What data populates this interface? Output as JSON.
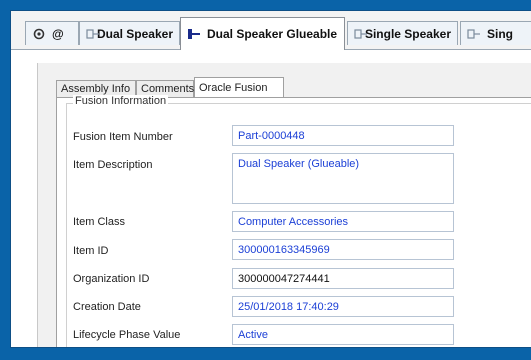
{
  "top_tabs": [
    {
      "label": "@",
      "icon": "settings-icon"
    },
    {
      "label": "Dual Speaker",
      "icon": "component-icon"
    },
    {
      "label": "Dual Speaker Glueable",
      "icon": "connector-icon",
      "active": true
    },
    {
      "label": "Single Speaker",
      "icon": "component-icon"
    },
    {
      "label": "Sing",
      "icon": "component-icon"
    }
  ],
  "sub_tabs": [
    {
      "label": "Assembly Info"
    },
    {
      "label": "Comments"
    },
    {
      "label": "Oracle Fusion",
      "active": true
    }
  ],
  "group": {
    "label": "Fusion Information"
  },
  "fields": [
    {
      "label": "Fusion Item Number",
      "value": "Part-0000448"
    },
    {
      "label": "Item Description",
      "value": "Dual Speaker (Glueable)"
    },
    {
      "label": "Item Class",
      "value": "Computer Accessories"
    },
    {
      "label": "Item ID",
      "value": "300000163345969"
    },
    {
      "label": "Organization ID",
      "value": "300000047274441"
    },
    {
      "label": "Creation Date",
      "value": "25/01/2018 17:40:29"
    },
    {
      "label": "Lifecycle Phase Value",
      "value": "Active"
    }
  ]
}
